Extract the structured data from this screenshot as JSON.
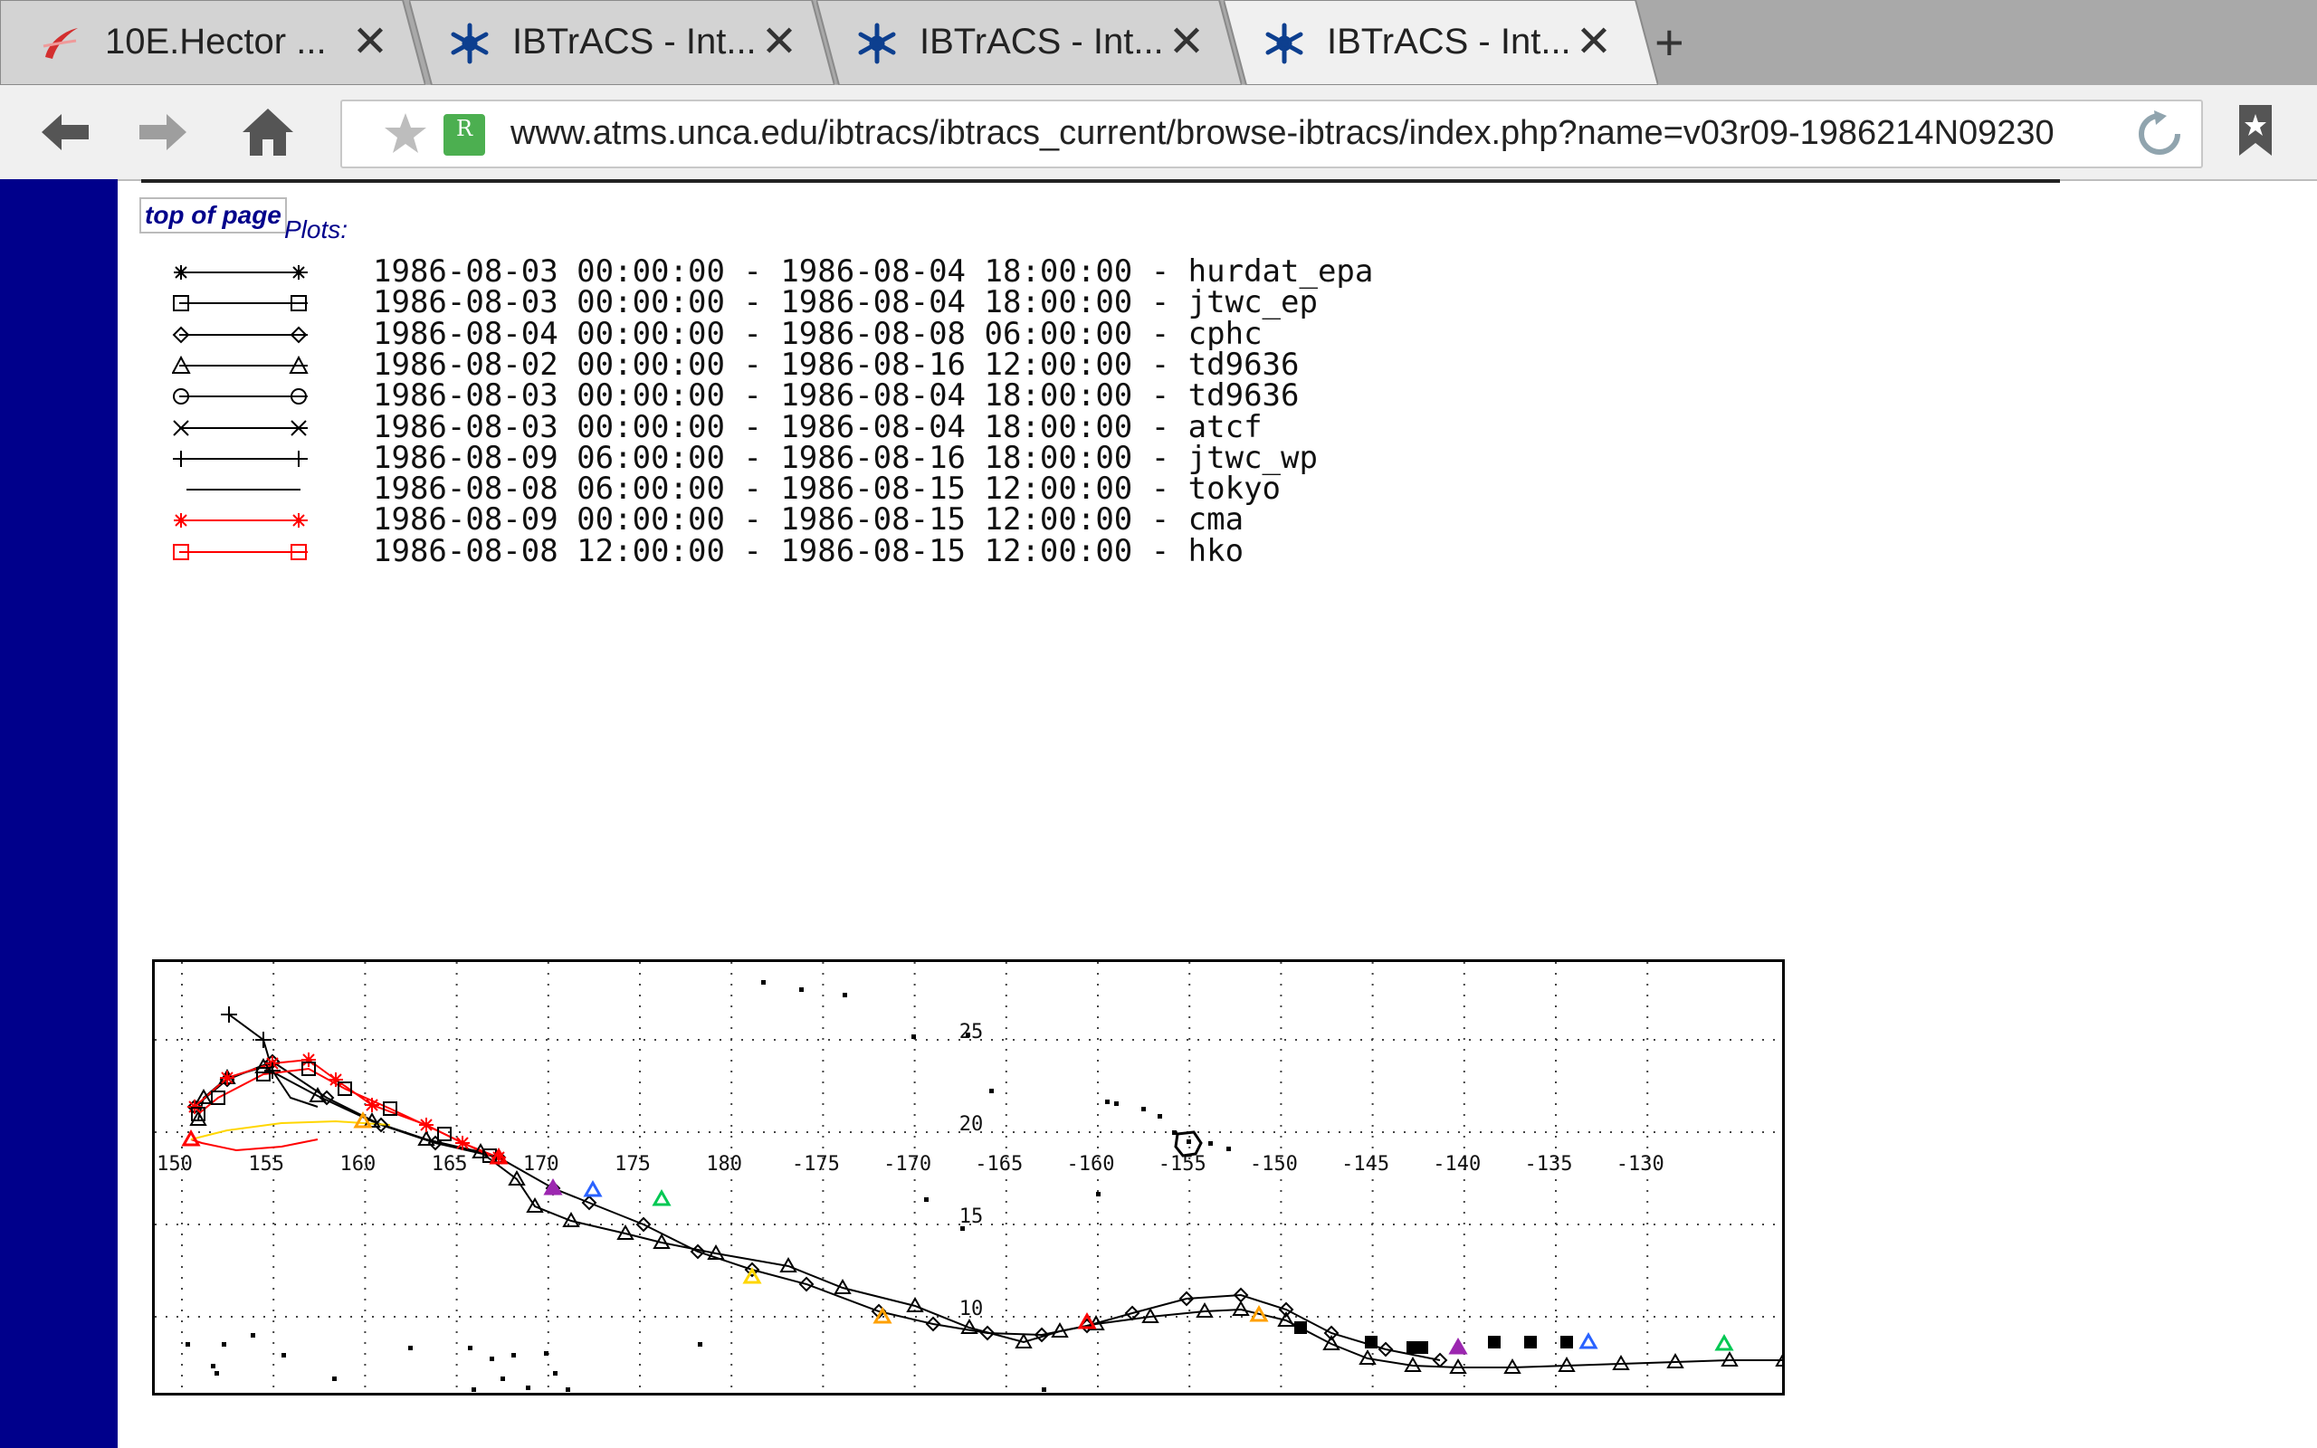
{
  "browser": {
    "tabs": [
      {
        "title": "10E.Hector ...",
        "icon": "swirl-icon"
      },
      {
        "title": "IBTrACS - Int...",
        "icon": "snowflake-icon"
      },
      {
        "title": "IBTrACS - Int...",
        "icon": "snowflake-icon"
      },
      {
        "title": "IBTrACS - Int...",
        "icon": "snowflake-icon"
      }
    ],
    "new_tab": "+",
    "close_glyph": "✕",
    "url": "www.atms.unca.edu/ibtracs/ibtracs_current/browse-ibtracs/index.php?name=v03r09-1986214N09230",
    "rbadge": "R"
  },
  "page": {
    "top_link": "top of page",
    "plots_label": "Plots:",
    "legend": [
      {
        "range": "1986-08-03 00:00:00 - 1986-08-04 18:00:00 - hurdat_epa",
        "marker": "asterisk",
        "color": "#000000"
      },
      {
        "range": "1986-08-03 00:00:00 - 1986-08-04 18:00:00 - jtwc_ep",
        "marker": "square",
        "color": "#000000"
      },
      {
        "range": "1986-08-04 00:00:00 - 1986-08-08 06:00:00 - cphc",
        "marker": "diamond",
        "color": "#000000"
      },
      {
        "range": "1986-08-02 00:00:00 - 1986-08-16 12:00:00 - td9636",
        "marker": "triangle",
        "color": "#000000"
      },
      {
        "range": "1986-08-03 00:00:00 - 1986-08-04 18:00:00 - td9636",
        "marker": "circle",
        "color": "#000000"
      },
      {
        "range": "1986-08-03 00:00:00 - 1986-08-04 18:00:00 - atcf",
        "marker": "x",
        "color": "#000000"
      },
      {
        "range": "1986-08-09 06:00:00 - 1986-08-16 18:00:00 - jtwc_wp",
        "marker": "plus",
        "color": "#000000"
      },
      {
        "range": "1986-08-08 06:00:00 - 1986-08-15 12:00:00 - tokyo",
        "marker": "none",
        "color": "#000000"
      },
      {
        "range": "1986-08-09 00:00:00 - 1986-08-15 12:00:00 - cma",
        "marker": "asterisk",
        "color": "#ff0000"
      },
      {
        "range": "1986-08-08 12:00:00 - 1986-08-15 12:00:00 - hko",
        "marker": "square",
        "color": "#ff0000"
      }
    ],
    "map": {
      "lon_labels": [
        "150",
        "155",
        "160",
        "165",
        "170",
        "175",
        "180",
        "-175",
        "-170",
        "-165",
        "-160",
        "-155",
        "-150",
        "-145",
        "-140",
        "-135",
        "-130"
      ],
      "lat_labels": [
        "25",
        "20",
        "15",
        "10"
      ]
    }
  }
}
